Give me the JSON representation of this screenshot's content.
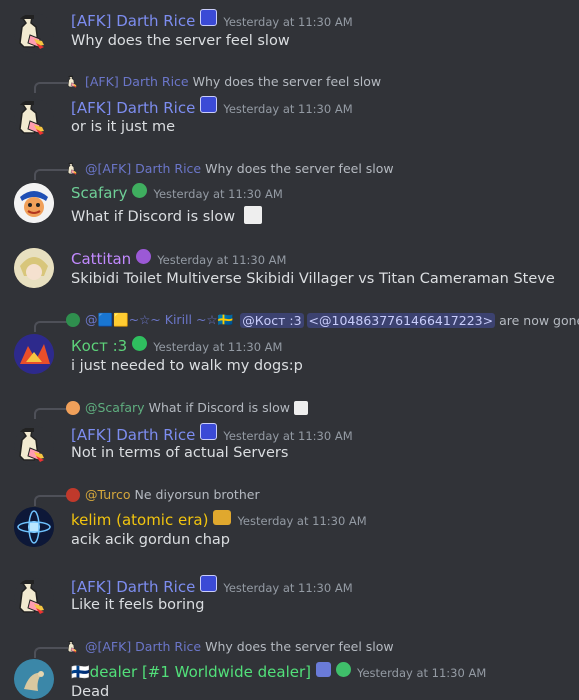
{
  "colors": {
    "background": "#313338",
    "afk_name": "#7d8df0",
    "scafary_name": "#6fcf97",
    "cattitan_name": "#c28aff",
    "kost_name": "#5dd37a",
    "kelim_name": "#f1c40f",
    "dealer_name": "#52e07a",
    "turco_name": "#d4a63c",
    "timestamp": "#949ba4"
  },
  "messages": [
    {
      "author": "[AFK] Darth Rice",
      "timestamp": "Yesterday at 11:30 AM",
      "text": "Why does the server feel slow"
    },
    {
      "reply": {
        "author": "[AFK] Darth Rice",
        "text": "Why does the server feel slow"
      },
      "author": "[AFK] Darth Rice",
      "timestamp": "Yesterday at 11:30 AM",
      "text": "or is it just me"
    },
    {
      "reply": {
        "author": "@[AFK] Darth Rice",
        "text": "Why does the server feel slow"
      },
      "author": "Scafary",
      "timestamp": "Yesterday at 11:30 AM",
      "text": "What if Discord is slow"
    },
    {
      "author": "Cattitan",
      "timestamp": "Yesterday at 11:30 AM",
      "text": "Skibidi Toilet Multiverse Skibidi Villager vs Titan Cameraman Steve"
    },
    {
      "reply": {
        "author": "@🟦🟨~☆~ Kirill ~☆🇸🇪",
        "mention1": "@Кост :3",
        "mention2": "<@1048637761466417223>",
        "text": "are now gone"
      },
      "author": "Кост :3",
      "timestamp": "Yesterday at 11:30 AM",
      "text": "i just needed to walk my dogs:p"
    },
    {
      "reply": {
        "author": "@Scafary",
        "text": "What if Discord is slow"
      },
      "author": "[AFK] Darth Rice",
      "timestamp": "Yesterday at 11:30 AM",
      "text": "Not in terms of actual Servers"
    },
    {
      "reply": {
        "author": "@Turco",
        "text": "Ne diyorsun brother"
      },
      "author": "kelim (atomic era)",
      "timestamp": "Yesterday at 11:30 AM",
      "text": "acik acik gordun chap"
    },
    {
      "author": "[AFK] Darth Rice",
      "timestamp": "Yesterday at 11:30 AM",
      "text": "Like it feels boring"
    },
    {
      "reply": {
        "author": "@[AFK] Darth Rice",
        "text": "Why does the server feel slow"
      },
      "author": "🇫🇮dealer [#1 Worldwide dealer]",
      "timestamp": "Yesterday at 11:30 AM",
      "text": "Dead"
    }
  ]
}
